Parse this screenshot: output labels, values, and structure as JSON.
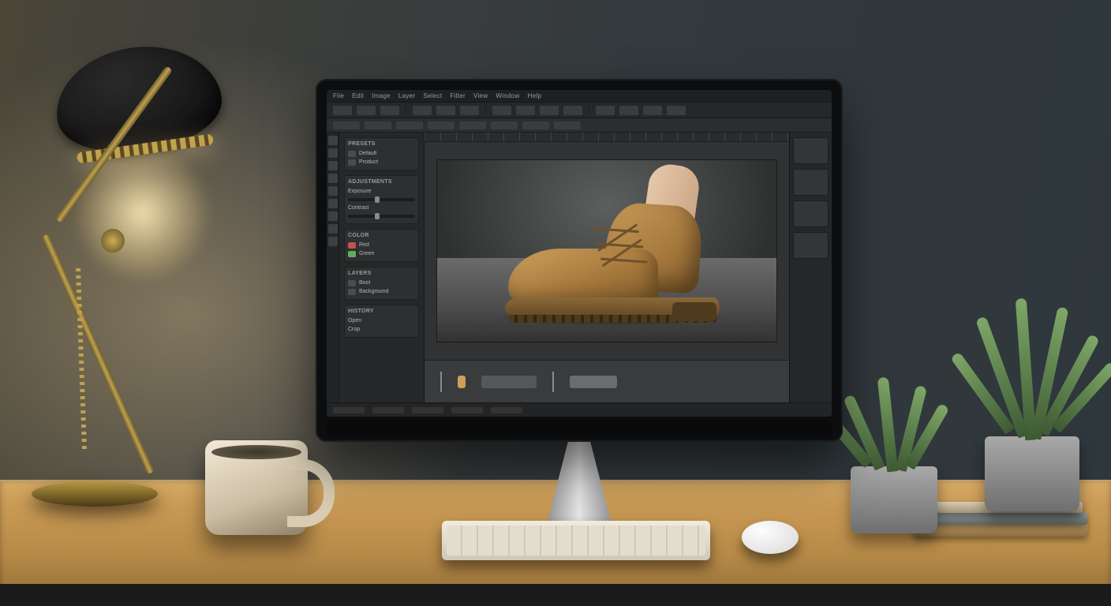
{
  "scene": {
    "description": "Photograph of a wooden desk at dusk with a warm desk lamp on the left, a white coffee mug, an aluminium all-in-one computer, a compact keyboard and mouse, two potted succulents and a small stack of books on the right.",
    "lighting": "warm lamp glow from left, cool ambient from right"
  },
  "monitor": {
    "app_kind": "dark-theme photo/graphics editor",
    "menubar": [
      "File",
      "Edit",
      "Image",
      "Layer",
      "Select",
      "Filter",
      "View",
      "Window",
      "Help"
    ],
    "toolbar_button_count": 14,
    "optionsbar_field_count": 8,
    "side_panels": {
      "groups": [
        {
          "title": "Presets",
          "items": [
            "Default",
            "Product"
          ]
        },
        {
          "title": "Adjustments",
          "items": [
            "Exposure",
            "Contrast"
          ]
        },
        {
          "title": "Color",
          "items": [
            "Red",
            "Green"
          ]
        },
        {
          "title": "Layers",
          "items": [
            "Boot",
            "Background"
          ]
        },
        {
          "title": "History",
          "items": [
            "Open",
            "Crop"
          ]
        }
      ]
    },
    "canvas_subject": "tan suede lace-up work boot on a grey studio floor, worn on a leg entering from upper right",
    "timeline_segments": 3,
    "footer_segments": 5,
    "right_thumb_count": 4
  }
}
